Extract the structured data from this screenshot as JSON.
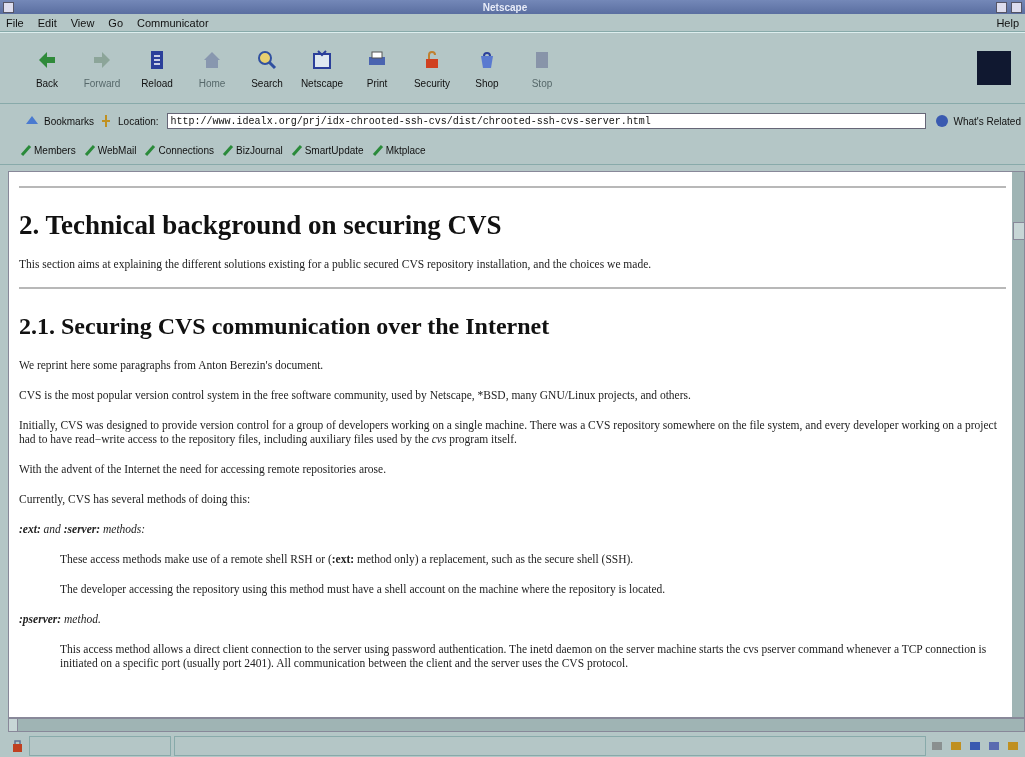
{
  "window": {
    "title": "Netscape"
  },
  "menu": [
    {
      "label": "File"
    },
    {
      "label": "Edit"
    },
    {
      "label": "View"
    },
    {
      "label": "Go"
    },
    {
      "label": "Communicator"
    }
  ],
  "help_menu": {
    "label": "Help"
  },
  "toolbar": {
    "buttons": [
      {
        "label": "Back",
        "disabled": false
      },
      {
        "label": "Forward",
        "disabled": true
      },
      {
        "label": "Reload",
        "disabled": false
      },
      {
        "label": "Home",
        "disabled": true
      },
      {
        "label": "Search",
        "disabled": false
      },
      {
        "label": "Netscape",
        "disabled": false
      },
      {
        "label": "Print",
        "disabled": false
      },
      {
        "label": "Security",
        "disabled": false
      },
      {
        "label": "Shop",
        "disabled": false
      },
      {
        "label": "Stop",
        "disabled": true
      }
    ]
  },
  "location_bar": {
    "bookmarks_label": "Bookmarks",
    "location_label": "Location:",
    "url": "http://www.idealx.org/prj/idx-chrooted-ssh-cvs/dist/chrooted-ssh-cvs-server.html",
    "related_label": "What's Related"
  },
  "personal_toolbar": [
    {
      "label": "Members"
    },
    {
      "label": "WebMail"
    },
    {
      "label": "Connections"
    },
    {
      "label": "BizJournal"
    },
    {
      "label": "SmartUpdate"
    },
    {
      "label": "Mktplace"
    }
  ],
  "content": [
    {
      "kind": "rule"
    },
    {
      "kind": "h1",
      "text": "2. Technical background on securing CVS"
    },
    {
      "kind": "p",
      "text": "This section aims at explaining the different solutions existing for a public secured CVS repository installation, and the choices we made."
    },
    {
      "kind": "rule"
    },
    {
      "kind": "h2",
      "text": "2.1. Securing CVS communication over the Internet"
    },
    {
      "kind": "p",
      "text": "We reprint here some paragraphs from Anton Berezin's document."
    },
    {
      "kind": "p",
      "text": "CVS is the most popular version control system in the free software community, used by Netscape, *BSD, many GNU/Linux projects, and others."
    },
    {
      "kind": "p",
      "text": "Initially, CVS was designed to provide version control for a group of developers working on a single machine. There was a CVS repository somewhere on the file system, and every developer working on a project had to have read−write access to the repository files, including auxiliary files used by the *cvs* program itself."
    },
    {
      "kind": "p",
      "text": "With the advent of the Internet the need for accessing remote repositories arose."
    },
    {
      "kind": "p",
      "text": "Currently, CVS has several methods of doing this:"
    },
    {
      "kind": "term",
      "text": "**:ext:** *and* **:server:** *methods:*"
    },
    {
      "kind": "dd",
      "text": "These access methods make use of a remote shell RSH or (**:ext:** method only) a replacement, such as the secure shell (SSH)."
    },
    {
      "kind": "dd",
      "text": "The developer accessing the repository using this method must have a shell account on the machine where the repository is located."
    },
    {
      "kind": "term",
      "text": "**:pserver:** *method.*"
    },
    {
      "kind": "dd",
      "text": "This access method allows a direct client connection to the server using password authentication. The inetd daemon on the server machine starts the cvs pserver command whenever a TCP connection is initiated on a specific port (usually port 2401). All communication between the client and the server uses the CVS protocol."
    }
  ]
}
